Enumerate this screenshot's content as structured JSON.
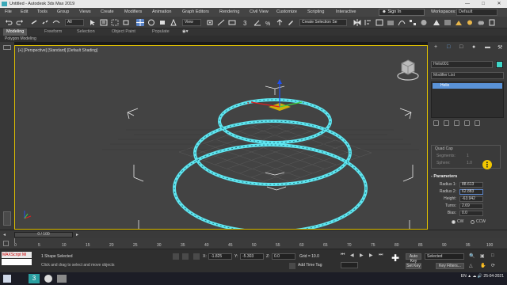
{
  "window": {
    "title": "Untitled - Autodesk 3ds Max 2019"
  },
  "menu": {
    "items": [
      "File",
      "Edit",
      "Tools",
      "Group",
      "Views",
      "Create",
      "Modifiers",
      "Animation",
      "Graph Editors",
      "Rendering",
      "Civil View",
      "Customize",
      "Scripting",
      "Interactive"
    ],
    "signin": "Sign In",
    "workspaces_label": "Workspaces:",
    "workspace": "Default"
  },
  "toolbar": {
    "selection_filter": "All",
    "view_dd": "View",
    "create_selection": "Create Selection Se"
  },
  "ribbon": {
    "tabs": [
      "Modeling",
      "Freeform",
      "Selection",
      "Object Paint",
      "Populate"
    ],
    "active": "Modeling",
    "sub": "Polygon Modeling"
  },
  "viewport": {
    "label": "[+] [Perspective] [Standard] [Default Shading]"
  },
  "command_panel": {
    "object_name": "Helix001",
    "object_color": "#3ed6c8",
    "modifier_list": "Modifier List",
    "stack_item": "Helix",
    "quad_cap": "Quad Cap",
    "segments_label": "Segments:",
    "segments_value": "1",
    "sphere_label": "Sphere:",
    "sphere_value": "1.0",
    "params_title": "Parameters",
    "params": [
      {
        "label": "Radius 1:",
        "value": "88.613"
      },
      {
        "label": "Radius 2:",
        "value": "62.883"
      },
      {
        "label": "Height:",
        "value": "-63.942"
      },
      {
        "label": "Turns:",
        "value": "2.69"
      },
      {
        "label": "Bias:",
        "value": "0.0"
      }
    ],
    "cw": "CW",
    "ccw": "CCW"
  },
  "timeline": {
    "frame": "0 / 100",
    "ticks": [
      "0",
      "5",
      "10",
      "15",
      "20",
      "25",
      "30",
      "35",
      "40",
      "45",
      "50",
      "55",
      "60",
      "65",
      "70",
      "75",
      "80",
      "85",
      "90",
      "95",
      "100"
    ]
  },
  "status": {
    "maxscript": "MAXScript Mi",
    "selection": "1 Shape Selected",
    "prompt": "Click and drag to select and move objects",
    "x": "-1.825",
    "y": "-5.303",
    "z": "0.0",
    "grid": "Grid = 10.0",
    "add_time_tag": "Add Time Tag",
    "autokey": "Auto Key",
    "setkey": "Set Key",
    "selected": "Selected",
    "keyfilters": "Key Filters..."
  },
  "taskbar": {
    "lang": "EN",
    "time": "",
    "date": "25-04-2021"
  }
}
